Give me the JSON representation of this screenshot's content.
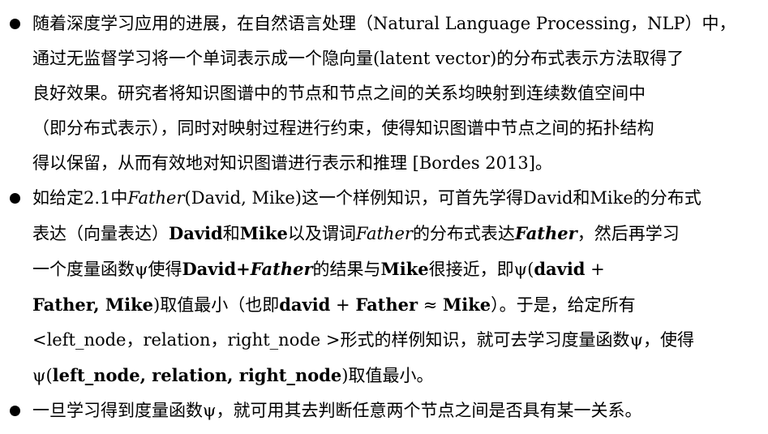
{
  "bullets": [
    {
      "line1": "随着深度学习应用的进展，在自然语言处理（Natural Language Processing，NLP）中，",
      "line2": "通过无监督学习将一个单词表示成一个隐向量(latent vector)的分布式表示方法取得了",
      "line3": "良好效果。研究者将知识图谱中的节点和节点之间的关系均映射到连续数值空间中",
      "line4": "（即分布式表示），同时对映射过程进行约束，使得知识图谱中节点之间的拓扑结构",
      "line5": "得以保留，从而有效地对知识图谱进行表示和推理 [Bordes 2013]。"
    },
    {
      "l1_a": "如给定2.1中",
      "l1_father": "Father",
      "l1_b": "(David, Mike)这一个样例知识，可首先学得David和Mike的分布式",
      "l2_a": "表达（向量表达）",
      "l2_david": "David",
      "l2_and": "和",
      "l2_mike": "Mike",
      "l2_b": "以及谓词",
      "l2_father": "Father",
      "l2_c": "的分布式表达",
      "l2_father_bold": "Father",
      "l2_d": "，然后再学习",
      "l3_a": "一个度量函数ψ使得",
      "l3_david": "David+",
      "l3_father": "Father",
      "l3_b": "的结果与",
      "l3_mike": "Mike",
      "l3_c": "很接近，即ψ(",
      "l3_expr": "david",
      "l3_plus": " +",
      "l4_expr1": "Father, Mike",
      "l4_a": ")取值最小（也即",
      "l4_expr2": "david",
      "l4_plus": " + ",
      "l4_expr3": "Father",
      "l4_approx": " ≈ ",
      "l4_expr4": "Mike",
      "l4_b": "）。于是，给定所有",
      "line5": "<left_node，relation，right_node >形式的样例知识，就可去学习度量函数ψ，使得",
      "l6_a": "ψ(",
      "l6_expr": "left_node, relation, right_node",
      "l6_b": ")取值最小。"
    },
    {
      "line1": "一旦学习得到度量函数ψ，就可用其去判断任意两个节点之间是否具有某一关系。"
    }
  ]
}
